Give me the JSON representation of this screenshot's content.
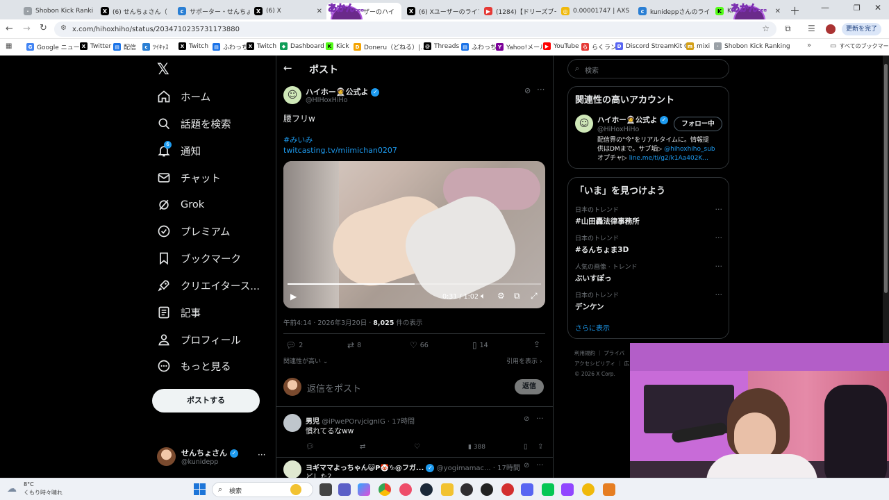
{
  "browser": {
    "tabs": [
      {
        "label": "Shobon Kick Ranki",
        "color": "#9aa0a6",
        "glyph": "·"
      },
      {
        "label": "(6) せんちょさん（",
        "color": "#000000",
        "glyph": "X"
      },
      {
        "label": "サポーター・せんちょ",
        "color": "#2a7fd4",
        "glyph": "c"
      },
      {
        "label": "(6) X",
        "color": "#000000",
        "glyph": "X"
      },
      {
        "label": "ザーのハイ",
        "color": "#a56bd6",
        "glyph": "あ"
      },
      {
        "label": "(6) Xユーザーのライブ",
        "color": "#000000",
        "glyph": "X"
      },
      {
        "label": "(1284)【ドリーズブー",
        "color": "#e53935",
        "glyph": "▶"
      },
      {
        "label": "0.00001747 | AXS",
        "color": "#f0b90b",
        "glyph": "◎"
      },
      {
        "label": "kunideppさんのライ",
        "color": "#2a7fd4",
        "glyph": "c"
      },
      {
        "label": "Ki",
        "color": "#53fc18",
        "glyph": "K"
      }
    ],
    "overlay_text": "あかん…",
    "url": "x.com/hihoxhiho/status/2034710235731173880",
    "update_label": "更新を完了",
    "bookmarks": [
      {
        "label": "Google ニュース",
        "color": "#4285f4",
        "glyph": "G"
      },
      {
        "label": "Twitter",
        "color": "#000000",
        "glyph": "X"
      },
      {
        "label": "配信",
        "color": "#1a73e8",
        "glyph": "▤"
      },
      {
        "label": "ﾂｲｷｬｽ",
        "color": "#2a7fd4",
        "glyph": "c"
      },
      {
        "label": "Twitch",
        "color": "#000000",
        "glyph": "X"
      },
      {
        "label": "ふわっち",
        "color": "#1a73e8",
        "glyph": "▤"
      },
      {
        "label": "Twitch",
        "color": "#000000",
        "glyph": "X"
      },
      {
        "label": "Dashboard",
        "color": "#0f9d58",
        "glyph": "◆"
      },
      {
        "label": "Kick",
        "color": "#53fc18",
        "glyph": "K"
      },
      {
        "label": "Doneru（どねる）|...",
        "color": "#f4a300",
        "glyph": "D"
      },
      {
        "label": "Threads",
        "color": "#000000",
        "glyph": "@"
      },
      {
        "label": "ふわっち",
        "color": "#1a73e8",
        "glyph": "▤"
      },
      {
        "label": "Yahoo!メール",
        "color": "#7b0099",
        "glyph": "Y"
      },
      {
        "label": "YouTube",
        "color": "#ff0000",
        "glyph": "▶"
      },
      {
        "label": "らくラン",
        "color": "#e53935",
        "glyph": "ら"
      },
      {
        "label": "Discord StreamKit O...",
        "color": "#5865f2",
        "glyph": "D"
      },
      {
        "label": "mixi",
        "color": "#d4a017",
        "glyph": "m"
      },
      {
        "label": "Shobon Kick Ranking",
        "color": "#9aa0a6",
        "glyph": "·"
      }
    ],
    "all_bookmarks": "すべてのブックマーク"
  },
  "nav": {
    "items": [
      {
        "label": "ホーム",
        "icon": "home-icon"
      },
      {
        "label": "話題を検索",
        "icon": "search-icon"
      },
      {
        "label": "通知",
        "icon": "bell-icon",
        "badge": "6"
      },
      {
        "label": "チャット",
        "icon": "mail-icon"
      },
      {
        "label": "Grok",
        "icon": "grok-icon"
      },
      {
        "label": "プレミアム",
        "icon": "premium-icon"
      },
      {
        "label": "ブックマーク",
        "icon": "bookmark-icon"
      },
      {
        "label": "クリエイタース...",
        "icon": "rocket-icon"
      },
      {
        "label": "記事",
        "icon": "article-icon"
      },
      {
        "label": "プロフィール",
        "icon": "profile-icon"
      },
      {
        "label": "もっと見る",
        "icon": "more-icon"
      }
    ],
    "post_button": "ポストする",
    "account": {
      "name": "せんちょさん",
      "handle": "@kunidepp"
    }
  },
  "post": {
    "header_title": "ポスト",
    "author": {
      "name": "ハイホー🧑‍🚀公式よ",
      "handle": "@HIHoxHiHo"
    },
    "text": "腰フリw",
    "hashtag": "#みいみ",
    "link": "twitcasting.tv/miimichan0207",
    "video": {
      "time": "0:31 / 1:02",
      "progress": 0.5
    },
    "meta_time": "午前4:14 · 2026年3月20日 · ",
    "views_count": "8,025",
    "views_label": " 件の表示",
    "actions": {
      "replies": "2",
      "reposts": "8",
      "likes": "66",
      "bookmarks": "14"
    },
    "sort_label": "関連性が高い",
    "quote_label": "引用を表示",
    "reply_placeholder": "返信をポスト",
    "reply_button": "返信"
  },
  "replies": [
    {
      "name": "男児",
      "handle": "@iPwePOrvjcignIG",
      "time": "· 17時間",
      "text": "慣れてるなww",
      "views": "388"
    },
    {
      "name": "ヨギママよっちゃん😺P🤡♑@フガ...",
      "handle": "@yogimamac...",
      "time": "· 17時間",
      "text": "どした？"
    }
  ],
  "sidebar": {
    "search_placeholder": "検索",
    "related_title": "関連性の高いアカウント",
    "related_account": {
      "name": "ハイホー🧑‍🚀公式よ",
      "handle": "@HiHoxHiHo",
      "follow_label": "フォロー中",
      "bio_1": "配信界の\"今\"をリアルタイムに。情報提",
      "bio_2": "供はDMまで。サブ垢▷ ",
      "bio_2_link": "@hihoxhiho_sub",
      "bio_3": "オプチャ▷ ",
      "bio_3_link": "line.me/ti/g2/k1Aa402K..."
    },
    "trends_title": "「いま」を見つけよう",
    "trends": [
      {
        "category": "日本のトレンド",
        "name": "#山田轟法律事務所"
      },
      {
        "category": "日本のトレンド",
        "name": "#るんちょま3D"
      },
      {
        "category": "人気の画像 · トレンド",
        "name": "ぶいすぽっ"
      },
      {
        "category": "日本のトレンド",
        "name": "デンケン"
      }
    ],
    "show_more": "さらに表示",
    "footer_1": "利用規約 ｜ プライバ",
    "footer_2": "アクセシビリティ ｜ 広",
    "footer_3": "© 2026 X Corp."
  },
  "taskbar": {
    "weather_temp": "8°C",
    "weather_desc": "くもり時々晴れ",
    "search_label": "検索"
  },
  "colors": {
    "accent": "#1d9bf0",
    "badge": "#1d9bf0",
    "webcam_wall": "#c86bd8"
  }
}
